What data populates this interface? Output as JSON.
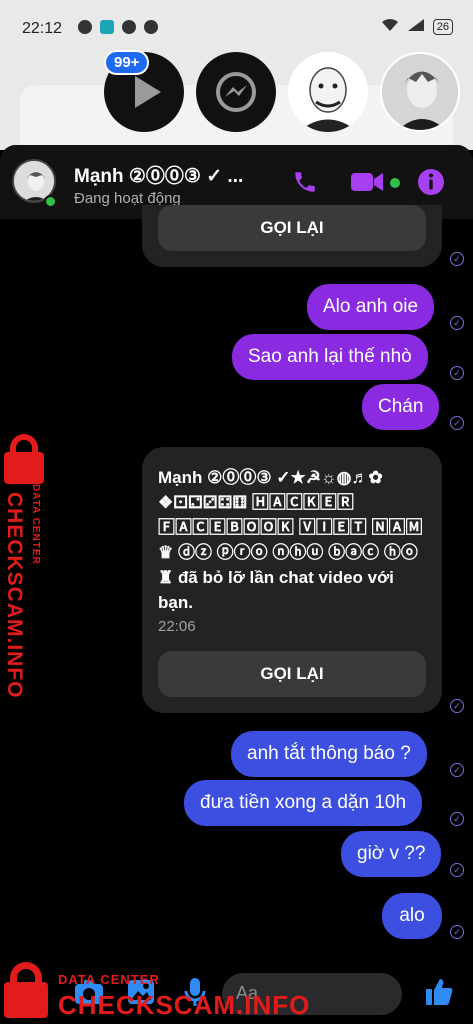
{
  "status_bar": {
    "time": "22:12",
    "battery": "26"
  },
  "chat_heads": {
    "badge": "99+"
  },
  "header": {
    "name": "Mạnh ②⓪⓪③ ✓ ...",
    "status": "Đang hoạt động"
  },
  "messages": {
    "missed_call_1_button": "GỌI LẠI",
    "m1": "Alo anh oie",
    "m2": "Sao anh lại thế nhò",
    "m3": "Chán",
    "card_text": "Mạnh ②⓪⓪③ ✓★☭☼◍♬✿ ❖⚀⚁⚂⚃⚅ 🄷🄰🄲🄺🄴🅁 🄵🄰🄲🄴🄱🄾🄾🄺 🅅🄸🄴🅃 🄽🄰🄼 ♛ ⓓⓩ ⓟⓡⓞ ⓝⓗⓤ ⓑⓐⓒ ⓗⓞ ♜ đã bỏ lỡ lần chat video với bạn.",
    "card_time": "22:06",
    "card_button": "GỌI LẠI",
    "m4": "anh tắt thông báo ?",
    "m5": "đưa tiền xong a dặn 10h",
    "m6": "giờ v ??",
    "m7": "alo"
  },
  "composer": {
    "placeholder": "Aa"
  },
  "watermark": {
    "small": "DATA CENTER",
    "big": "CHECKSCAM.INFO"
  },
  "colors": {
    "accent": "#8a2be2",
    "blue": "#3d4fe0",
    "watermark": "#e21b1b"
  }
}
